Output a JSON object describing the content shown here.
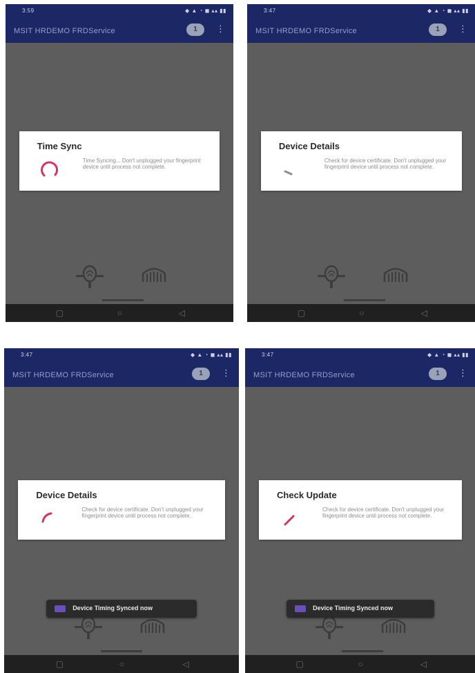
{
  "screens": [
    {
      "status_time": "3:59",
      "status_icons": "◆ ▲ ◔ ◼ ▴▴ ▮▮",
      "app_title": "MSIT HRDEMO FRDService",
      "count_badge": "1",
      "menu_icon": "overflow-menu-icon",
      "dialog": {
        "title": "Time Sync",
        "message": "Time Syncing... Don't unplugged your fingerprint device until process not complete."
      },
      "toast": null
    },
    {
      "status_time": "3:47",
      "status_icons": "◆ ▲ ◔ ◼ ▴▴ ▮▮",
      "app_title": "MSIT HRDEMO FRDService",
      "count_badge": "1",
      "menu_icon": "overflow-menu-icon",
      "dialog": {
        "title": "Device Details",
        "message": "Check for device certificate. Don't unplugged your fingerprint device until process not complete."
      },
      "toast": null
    },
    {
      "status_time": "3:47",
      "status_icons": "◆ ▲ ◔ ◼ ▴▴ ▮▮",
      "app_title": "MSIT HRDEMO FRDService",
      "count_badge": "1",
      "menu_icon": "overflow-menu-icon",
      "dialog": {
        "title": "Device Details",
        "message": "Check for device certificate. Don't unplugged your fingerprint device until process not complete."
      },
      "toast": "Device Timing Synced now"
    },
    {
      "status_time": "3:47",
      "status_icons": "◆ ▲ ◔ ◼ ▴▴ ▮▮",
      "app_title": "MSIT HRDEMO FRDService",
      "count_badge": "1",
      "menu_icon": "overflow-menu-icon",
      "dialog": {
        "title": "Check Update",
        "message": "Check for device certificate. Don't unplugged your fingerprint device until process not complete."
      },
      "toast": "Device Timing Synced now"
    }
  ],
  "colors": {
    "appbar": "#1c2866",
    "overlay": "#5e5e5e",
    "spinner": "#d6335f",
    "toast_bg": "#2b2b2b",
    "toast_icon": "#6a4fb8"
  },
  "icons": {
    "fingerprint": "fingerprint-scanner-icon",
    "iris": "iris-scanner-icon",
    "spinner": "progress-spinner-icon",
    "nav_back": "back-icon",
    "nav_home": "home-icon",
    "nav_recents": "recents-icon"
  }
}
